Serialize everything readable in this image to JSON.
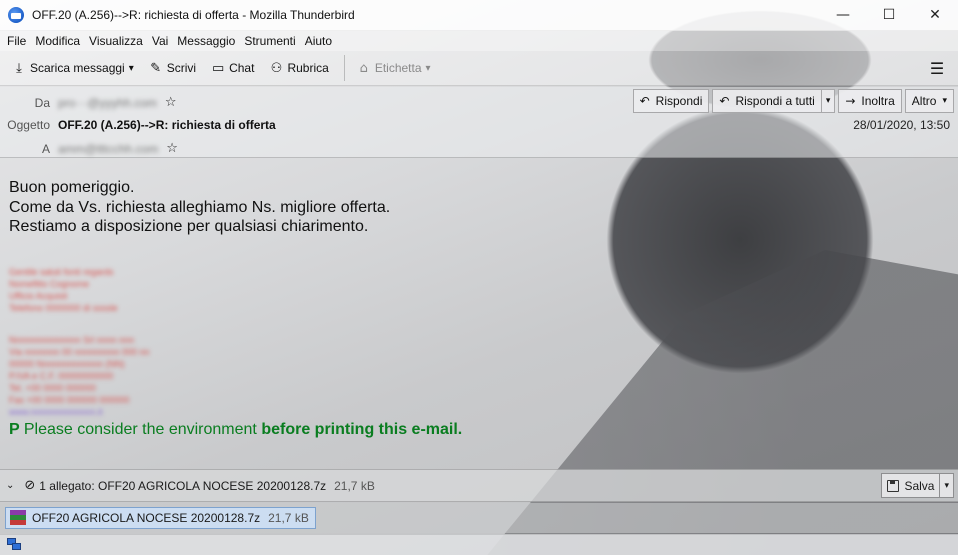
{
  "window": {
    "title": "OFF.20 (A.256)-->R: richiesta di offerta - Mozilla Thunderbird",
    "minimize": "—",
    "maximize": "☐",
    "close": "✕"
  },
  "menu": [
    "File",
    "Modifica",
    "Visualizza",
    "Vai",
    "Messaggio",
    "Strumenti",
    "Aiuto"
  ],
  "toolbar": {
    "get_messages": "Scarica messaggi",
    "write": "Scrivi",
    "chat": "Chat",
    "address_book": "Rubrica",
    "tag": "Etichetta",
    "icons": {
      "get_messages": "download-icon",
      "write": "pencil-icon",
      "chat": "chat-bubble-icon",
      "address_book": "contacts-icon",
      "tag": "tag-icon",
      "menu": "hamburger-menu-icon"
    }
  },
  "header": {
    "from_label": "Da",
    "from_value": "pro···@yyyhh.com",
    "subject_label": "Oggetto",
    "subject": "OFF.20 (A.256)-->R: richiesta di offerta",
    "to_label": "A",
    "to_value": "amm@tttcchh.com",
    "date": "28/01/2020, 13:50",
    "buttons": {
      "reply": "Rispondi",
      "reply_all": "Rispondi a tutti",
      "forward": "Inoltra",
      "more": "Altro"
    }
  },
  "body": {
    "lines": [
      "Buon pomeriggio.",
      "Come da Vs. richiesta alleghiamo Ns. migliore offerta.",
      "Restiamo a disposizione per qualsiasi chiarimento."
    ],
    "signature_block_1": [
      "Gentile saluti fonti regards",
      "Nomefitto Cognome",
      "Ufficio Acquisti",
      "Telefono 0000000 di ssssle"
    ],
    "signature_block_2": [
      "Nnnnnnnnnnnnnn Srl nnnn nnn",
      "Via nnnnnnn 00 nnnnnnnnn 000 nn",
      "00000 Nnnnnnnnnnnnn (NN)",
      "P.IVA e C.F. 00000000000",
      "Tel. +00 0000 000000",
      "Fax +00 0000 000000 000000",
      "www.nnnnnnnnnnnnn.it"
    ],
    "env_note_p": "P",
    "env_note_a": "Please consider the environment",
    "env_note_b": "before printing this e-mail."
  },
  "attachments": {
    "summary": "1 allegato: OFF20 AGRICOLA NOCESE 20200128.7z",
    "summary_size": "21,7 kB",
    "save": "Salva",
    "items": [
      {
        "name": "OFF20 AGRICOLA NOCESE 20200128.7z",
        "size": "21,7 kB"
      }
    ]
  },
  "colors": {
    "env_note": "#0a7d20",
    "attachment_selected": "#cce0f8"
  }
}
